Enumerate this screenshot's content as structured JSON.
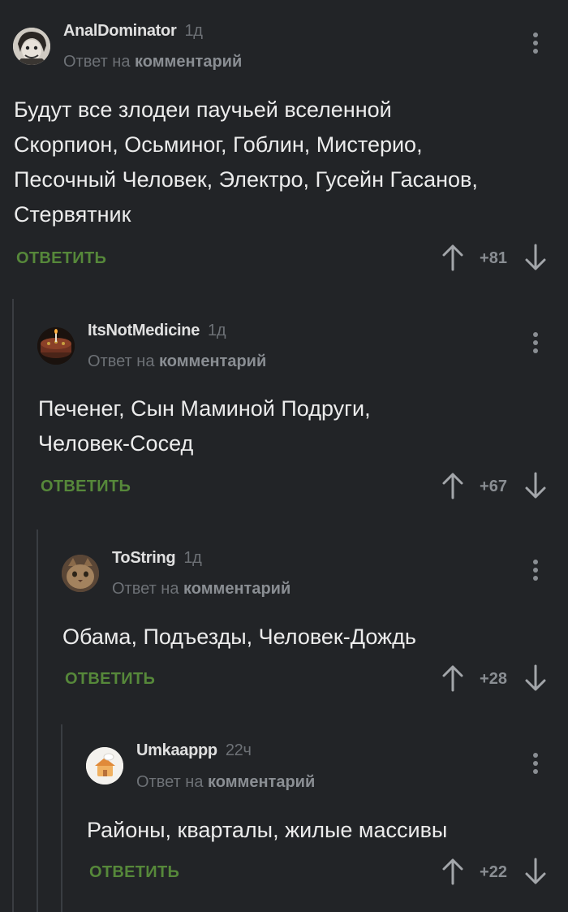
{
  "comments": [
    {
      "username": "AnalDominator",
      "time": "1д",
      "reply_prefix": "Ответ на",
      "reply_link": "комментарий",
      "lines": [
        "Будут все злодеи паучьей вселенной",
        "Скорпион, Осьминог, Гоблин, Мистерио,",
        "Песочный Человек, Электро, Гусейн Гасанов,",
        "Стервятник"
      ],
      "reply_label": "ОТВЕТИТЬ",
      "rating": "+81"
    },
    {
      "username": "ItsNotMedicine",
      "time": "1д",
      "reply_prefix": "Ответ на",
      "reply_link": "комментарий",
      "lines": [
        "Печенег, Сын Маминой Подруги,",
        "Человек-Сосед"
      ],
      "reply_label": "ОТВЕТИТЬ",
      "rating": "+67"
    },
    {
      "username": "ToString",
      "time": "1д",
      "reply_prefix": "Ответ на",
      "reply_link": "комментарий",
      "lines": [
        "Обама, Подъезды, Человек-Дождь"
      ],
      "reply_label": "ОТВЕТИТЬ",
      "rating": "+28"
    },
    {
      "username": "Umkaappp",
      "time": "22ч",
      "reply_prefix": "Ответ на",
      "reply_link": "комментарий",
      "lines": [
        "Районы, кварталы, жилые массивы"
      ],
      "reply_label": "ОТВЕТИТЬ",
      "rating": "+22"
    }
  ],
  "icons": {
    "vote_up": "arrow-up-icon",
    "vote_down": "arrow-down-icon",
    "more": "kebab-menu-icon"
  },
  "colors": {
    "background": "#222427",
    "reply_button": "#56883a",
    "muted": "#6d7176",
    "thread_line": "#3a3d42"
  }
}
